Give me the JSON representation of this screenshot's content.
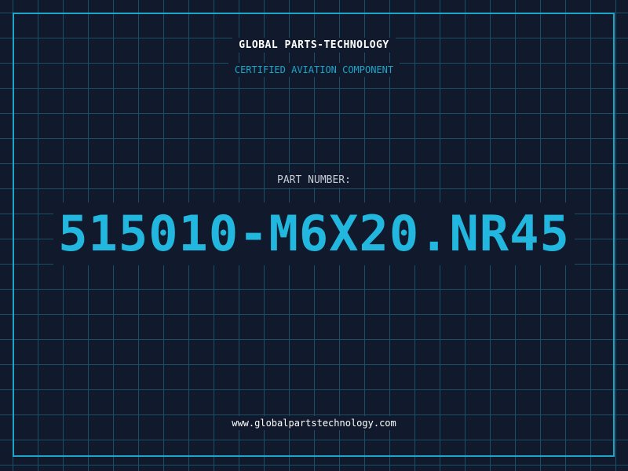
{
  "header": {
    "company": "GLOBAL PARTS-TECHNOLOGY",
    "subtitle": "CERTIFIED AVIATION COMPONENT"
  },
  "main": {
    "part_label": "PART NUMBER:",
    "part_number": "515010-M6X20.NR45"
  },
  "footer": {
    "website": "www.globalpartstechnology.com"
  },
  "colors": {
    "background": "#111a2c",
    "grid": "#1c4f66",
    "accent": "#22b7de",
    "text": "#ffffff"
  }
}
